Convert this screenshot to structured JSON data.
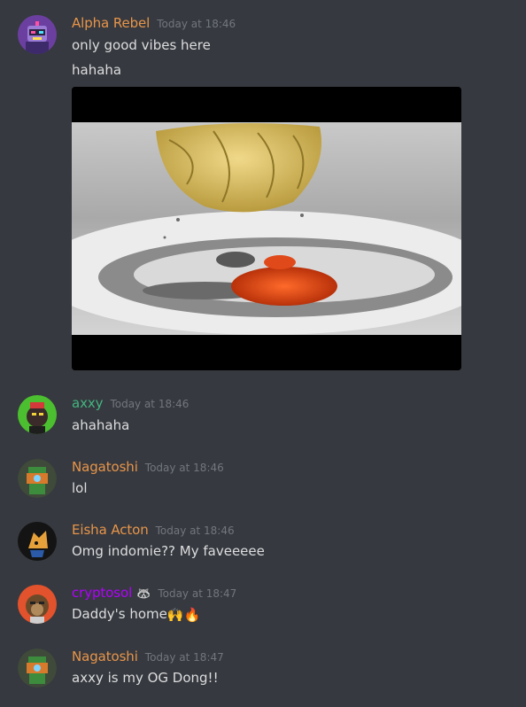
{
  "messages": [
    {
      "author": "Alpha Rebel",
      "author_color": "#e8954a",
      "timestamp": "Today at 18:46",
      "lines": [
        "only good vibes here",
        "hahaha"
      ],
      "attachment": "video-gif"
    },
    {
      "author": "axxy",
      "author_color": "#43b581",
      "timestamp": "Today at 18:46",
      "lines": [
        "ahahaha"
      ]
    },
    {
      "author": "Nagatoshi",
      "author_color": "#e8954a",
      "timestamp": "Today at 18:46",
      "lines": [
        "lol"
      ]
    },
    {
      "author": "Eisha Acton",
      "author_color": "#e8954a",
      "timestamp": "Today at 18:46",
      "lines": [
        "Omg indomie?? My faveeeee"
      ]
    },
    {
      "author": "cryptosol",
      "author_color": "#b300ff",
      "author_badge": "🦝",
      "timestamp": "Today at 18:47",
      "lines": [
        "Daddy's home"
      ],
      "emojis": [
        "🙌",
        "🔥"
      ]
    },
    {
      "author": "Nagatoshi",
      "author_color": "#e8954a",
      "timestamp": "Today at 18:47",
      "lines": [
        "axxy is my OG Dong!!"
      ]
    }
  ],
  "theme": {
    "background": "#36393f",
    "text": "#dcddde",
    "timestamp": "#72767d"
  }
}
